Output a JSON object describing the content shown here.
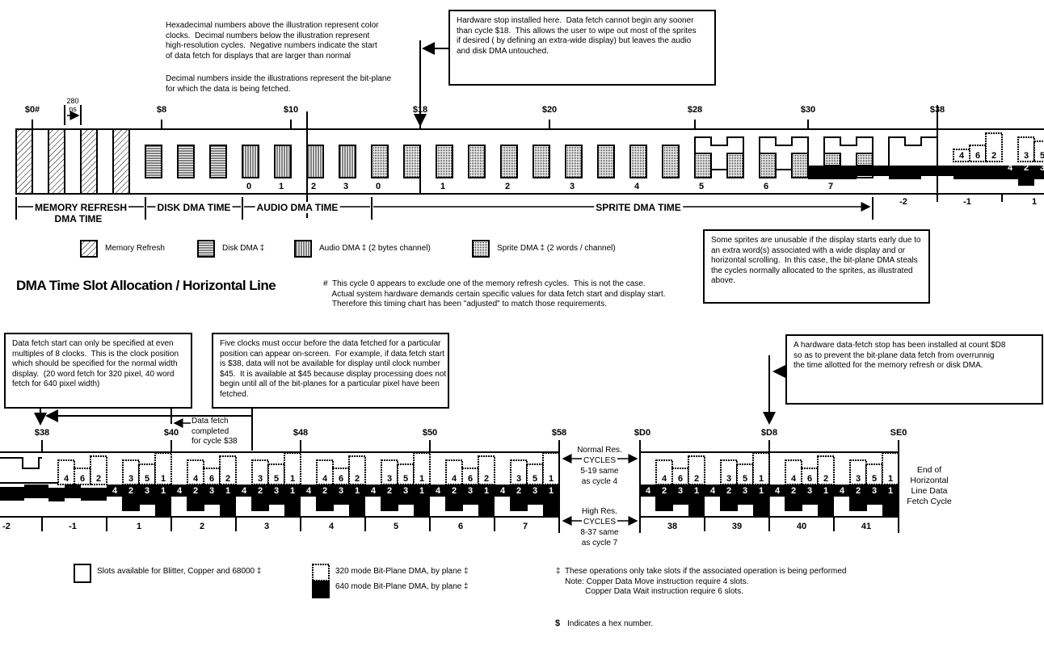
{
  "title": "DMA Time Slot Allocation / Horizontal Line",
  "notes": {
    "hex_explain": "Hexadecimal numbers above the illustration represent color\nclocks.  Decimal numbers below the illustration represent\nhigh-resolution cycles.  Negative numbers indicate the start\nof data fetch for displays that are larger than normal",
    "decimal_explain": "Decimal numbers inside the illustrations represent the bit-plane\nfor which the data is being fetched.",
    "hardware_stop": "Hardware stop installed here.  Data fetch cannot begin any sooner\nthan cycle $18.  This allows the user to wipe out most of the sprites\nif desired ( by defining an extra-wide display) but leaves the audio\nand disk DMA untouched.",
    "sprites_unusable": "Some sprites are unusable if the display starts early due to\nan extra word(s) associated with a wide display and or\nhorizontal scrolling.  In this case, the bit-plane DMA steals\nthe cycles normally allocated to the sprites, as illustrated\nabove.",
    "cycle0_note": "#  This cycle 0 appears to exclude one of the memory refresh cycles.  This is not the case.\n    Actual system hardware demands certain specific values for data fetch start and display start.\n    Therefore this timing chart has been \"adjusted\" to match those requirements.",
    "fetch_start": "Data fetch start can only be specified at even\nmultiples of 8 clocks.  This is the clock position\nwhich should be specified for the normal width\ndisplay.  (20 word fetch for 320 pixel, 40 word\nfetch for 640 pixel width)",
    "five_clocks": "Five clocks must occur before the data fetched for a particular\nposition can appear on-screen.  For example, if data fetch start\nis $38, data will not be available for display until clock number\n$45.  It is available at $45 because display processing does not\nbegin until all of the bit-planes for a particular pixel have been\nfetched.",
    "fetch_stop": "A hardware data-fetch stop has been installed at count $D8\nso as to prevent the bit-plane data fetch from overrunnig\nthe time allotted for the memory refresh or disk DMA.",
    "fetch_completed": "Data fetch\ncompleted\nfor cycle $38",
    "normal_res": "Normal Res.\nCYCLES\n5-19 same\nas cycle 4",
    "high_res": "High Res.\nCYCLES\n8-37 same\nas cycle 7",
    "end_of_line": "End of\nHorizontal\nLine Data\nFetch Cycle",
    "ops_note": "‡  These operations only take slots if the associated operation is being performed\n    Note: Copper Data Move instruction require 4 slots.\n             Copper Data Wait instruction require 6 slots.",
    "hex_note": "Indicates a hex number.",
    "ns_label": "280\nns"
  },
  "top_strip": {
    "hex_labels": [
      "$0#",
      "$8",
      "$10",
      "$18",
      "$20",
      "$28",
      "$30",
      "$38"
    ],
    "inner_cycle_labels": [
      "0",
      "1",
      "2",
      "3",
      "0",
      "1",
      "2",
      "3",
      "4",
      "5",
      "6",
      "7"
    ],
    "below_labels": [
      "-2",
      "-1",
      "1"
    ],
    "brackets": [
      "MEMORY REFRESH",
      "DMA TIME",
      "DISK DMA TIME",
      "AUDIO DMA TIME",
      "SPRITE DMA TIME"
    ]
  },
  "legend_top": [
    "Memory Refresh",
    "Disk DMA ‡",
    "Audio DMA ‡ (2 bytes channel)",
    "Sprite DMA ‡ (2 words / channel)"
  ],
  "legend_bottom": [
    "Slots available for Blitter, Copper and 68000 ‡",
    "320 mode Bit-Plane DMA, by plane ‡",
    "640 mode Bit-Plane DMA, by plane ‡"
  ],
  "bottom_strip": {
    "hex_labels": [
      "$38",
      "$40",
      "$48",
      "$50",
      "$58",
      "$D0",
      "$D8",
      "SE0"
    ],
    "cycle_labels": [
      "-2",
      "-1",
      "1",
      "2",
      "3",
      "4",
      "5",
      "6",
      "7",
      "38",
      "39",
      "40",
      "41"
    ],
    "lowres_planes": [
      "4",
      "6",
      "2",
      "3",
      "5",
      "1"
    ],
    "hires_planes": [
      "4",
      "2",
      "3",
      "1"
    ]
  }
}
